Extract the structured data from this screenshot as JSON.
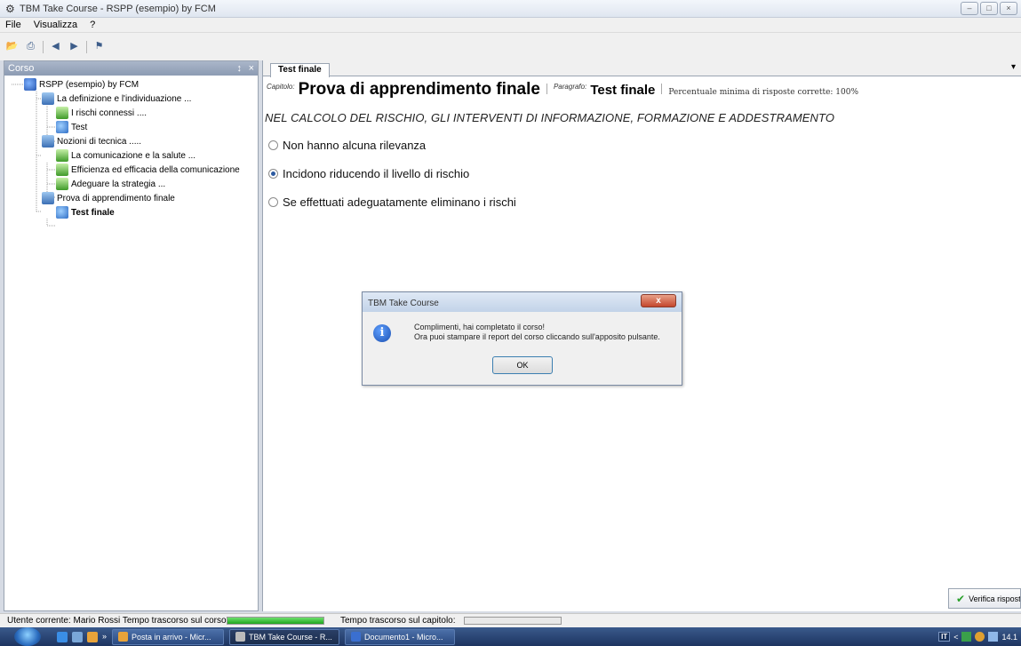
{
  "window": {
    "title": "TBM Take Course - RSPP (esempio) by FCM"
  },
  "menu": {
    "items": [
      "File",
      "Visualizza",
      "?"
    ]
  },
  "left_panel": {
    "title": "Corso",
    "pin": "↕",
    "close": "×",
    "tree": [
      {
        "label": "RSPP (esempio) by FCM",
        "type": "course",
        "level": 0
      },
      {
        "label": "La definizione e l'individuazione ...",
        "type": "chapter",
        "level": 1
      },
      {
        "label": "I rischi connessi ....",
        "type": "page",
        "level": 2
      },
      {
        "label": "Test",
        "type": "test",
        "level": 2
      },
      {
        "label": "Nozioni di tecnica .....",
        "type": "chapter",
        "level": 1
      },
      {
        "label": "La comunicazione e la salute ...",
        "type": "page",
        "level": 2
      },
      {
        "label": "Efficienza ed efficacia della comunicazione",
        "type": "page",
        "level": 2
      },
      {
        "label": "Adeguare la strategia ...",
        "type": "page",
        "level": 2
      },
      {
        "label": "Prova di apprendimento finale",
        "type": "chapter",
        "level": 1
      },
      {
        "label": "Test finale",
        "type": "test",
        "level": 2,
        "selected": true
      }
    ]
  },
  "main": {
    "tab_label": "Test finale",
    "tab_dropdown": "▾",
    "capitolo_label": "Capitolo:",
    "chapter_title": "Prova di apprendimento finale",
    "paragrafo_label": "Paragrafo:",
    "paragraph_title": "Test finale",
    "min_percent": "Percentuale minima di risposte corrette: 100%",
    "question": "NEL CALCOLO DEL RISCHIO, GLI INTERVENTI DI INFORMAZIONE, FORMAZIONE E ADDESTRAMENTO",
    "options": [
      {
        "label": "Non hanno alcuna rilevanza",
        "checked": false
      },
      {
        "label": "Incidono riducendo il livello di rischio",
        "checked": true
      },
      {
        "label": "Se effettuati adeguatamente eliminano i rischi",
        "checked": false
      }
    ],
    "verify_label": "Verifica rispost"
  },
  "dialog": {
    "title": "TBM Take Course",
    "close": "x",
    "info_glyph": "i",
    "message_line1": "Complimenti, hai completato il corso!",
    "message_line2": "Ora puoi stampare il report del corso cliccando sull'apposito pulsante.",
    "ok_label": "OK"
  },
  "status": {
    "user_text": "Utente corrente: Mario Rossi  Tempo trascorso sul corso:",
    "chapter_time_label": "Tempo trascorso sul capitolo:",
    "course_progress": 1.0,
    "chapter_progress": 0.0
  },
  "taskbar": {
    "tasks": [
      {
        "label": "Posta in arrivo - Micr...",
        "active": false
      },
      {
        "label": "TBM Take Course - R...",
        "active": true
      },
      {
        "label": "Documento1 - Micro...",
        "active": false
      }
    ],
    "language": "IT",
    "clock": "14.1",
    "chevrons": "»"
  },
  "colors": {
    "accent": "#2c5aa0",
    "progress": "#1ea51e",
    "taskbar": "#1d3460"
  }
}
